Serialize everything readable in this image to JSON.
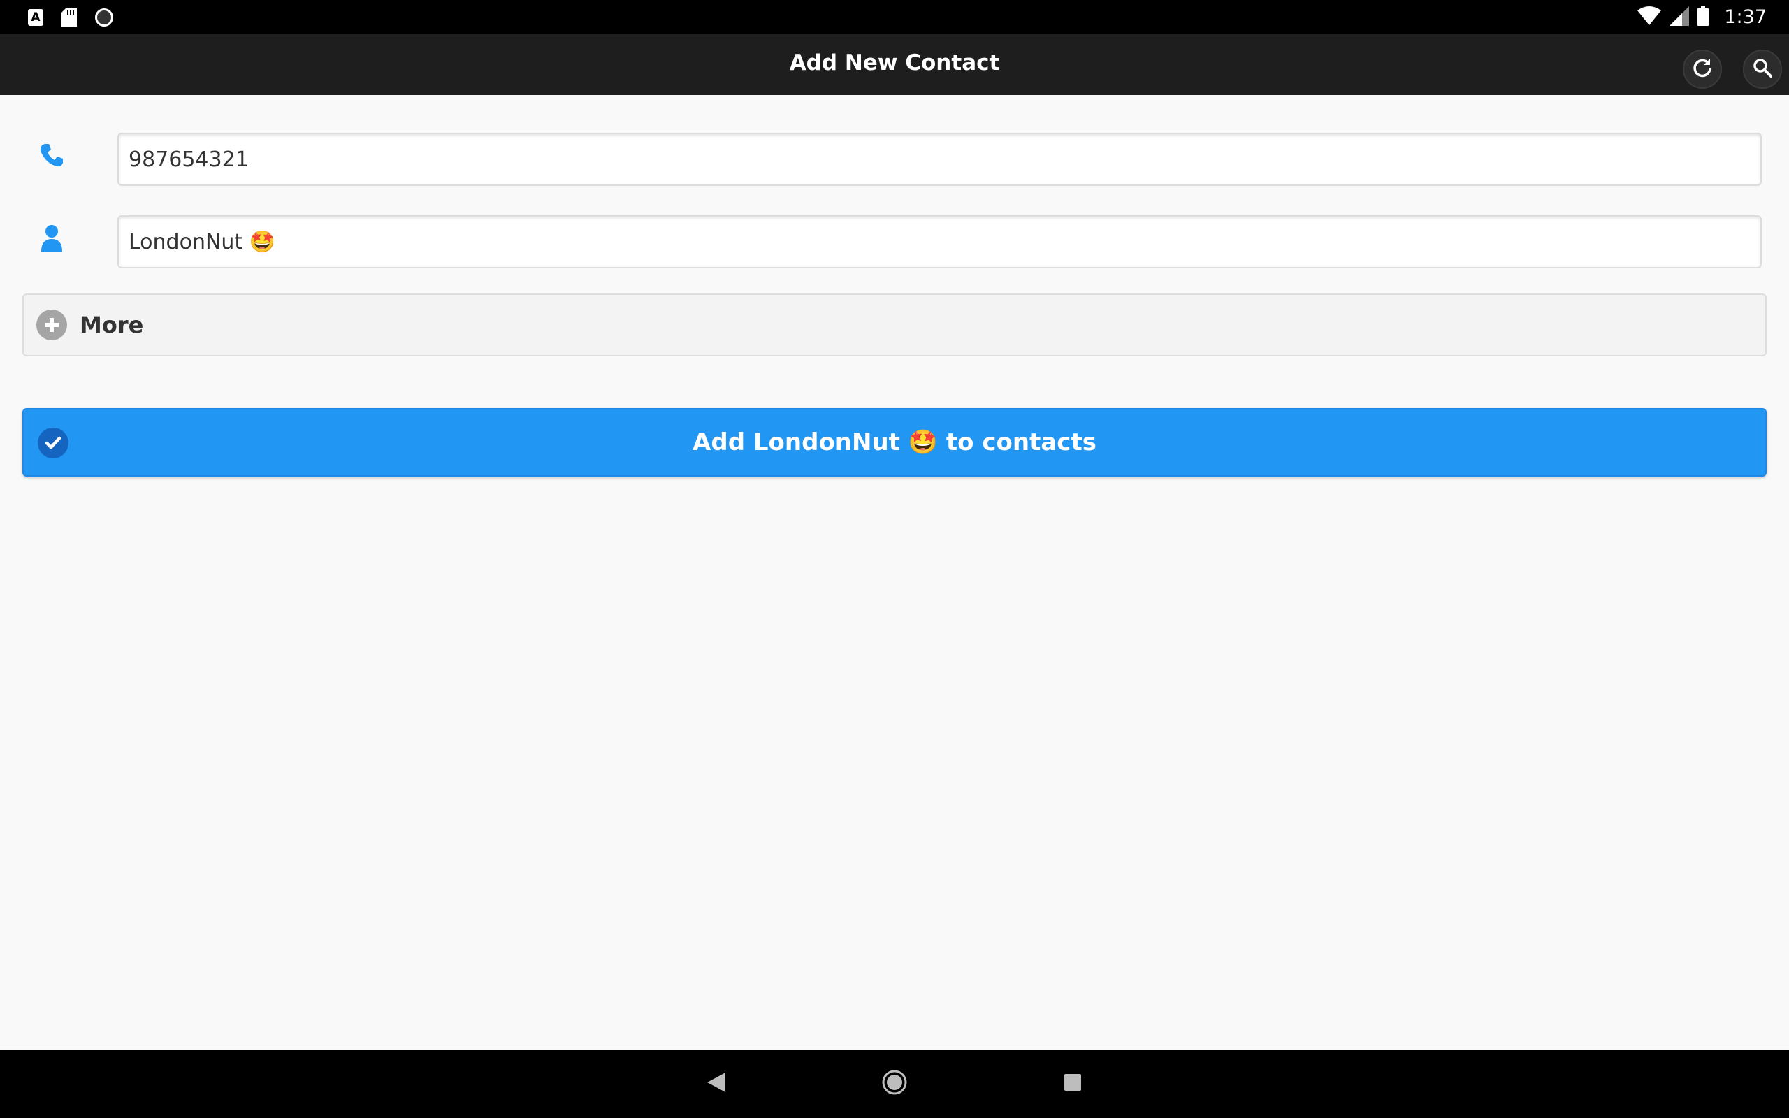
{
  "status_bar": {
    "time": "1:37",
    "left_icons": [
      "keyboard-a-icon",
      "sd-card-icon",
      "sync-circle-icon"
    ],
    "right_icons": [
      "wifi-icon",
      "cell-signal-icon",
      "battery-icon"
    ]
  },
  "app_bar": {
    "title": "Add New Contact",
    "actions": [
      "refresh-icon",
      "search-icon"
    ]
  },
  "form": {
    "phone": {
      "icon": "phone-icon",
      "value": "987654321"
    },
    "name": {
      "icon": "person-icon",
      "value": "LondonNut 🤩"
    },
    "more": {
      "icon": "plus-circle-icon",
      "label": "More"
    },
    "submit": {
      "icon": "check-circle-icon",
      "label": "Add LondonNut 🤩 to contacts"
    }
  },
  "nav_bar": {
    "buttons": [
      "back-icon",
      "home-icon",
      "recents-icon"
    ]
  },
  "colors": {
    "accent": "#2196f3",
    "app_bar": "#1e1e1e",
    "background": "#f9f9f9"
  }
}
